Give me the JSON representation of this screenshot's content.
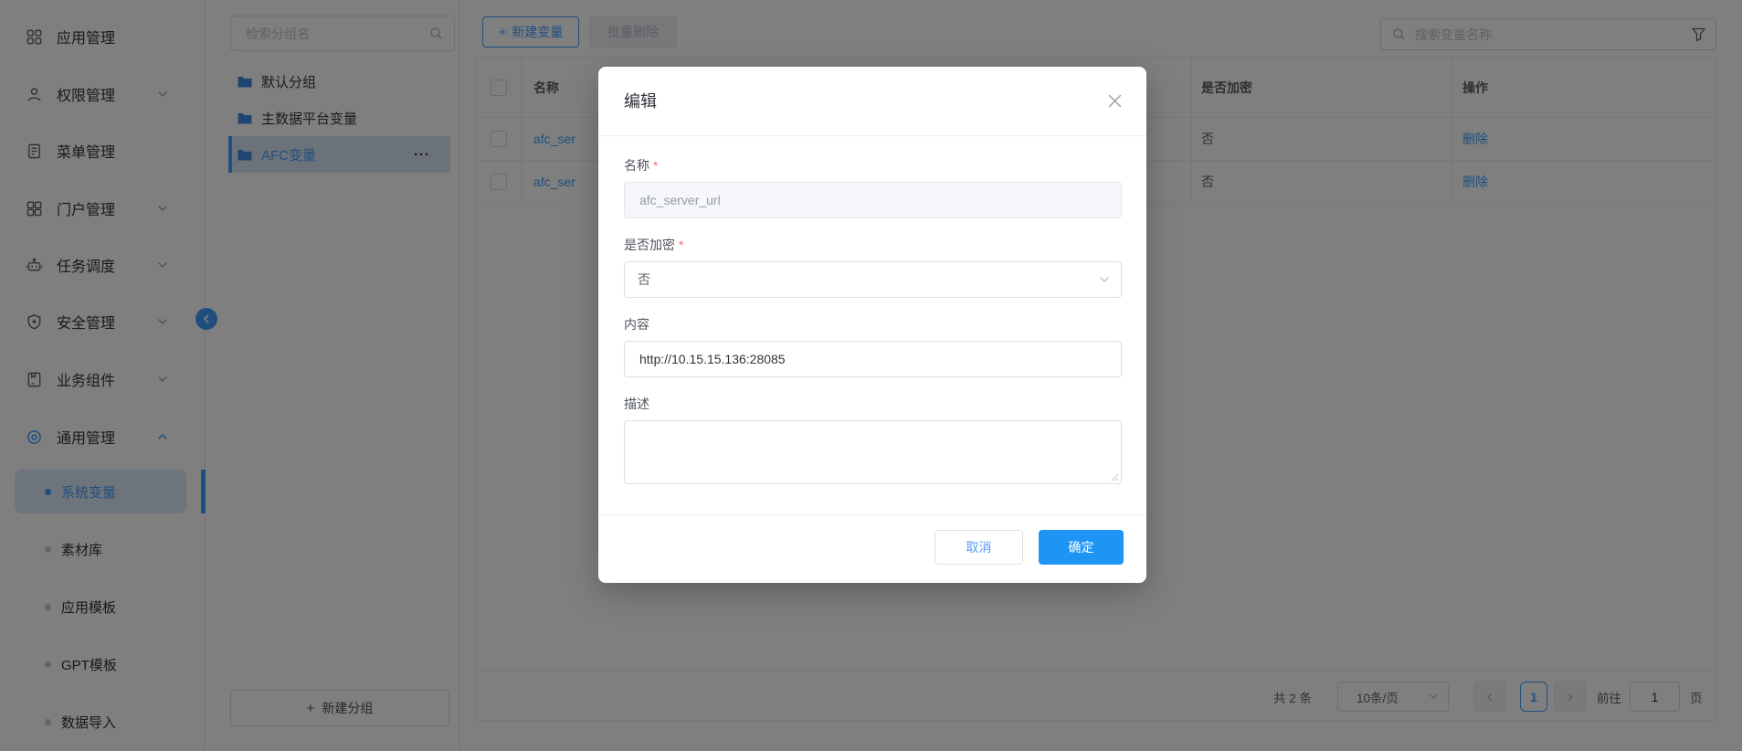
{
  "icons": {
    "plus": "+",
    "more": "···"
  },
  "sidebar": {
    "items": [
      {
        "label": "应用管理"
      },
      {
        "label": "权限管理"
      },
      {
        "label": "菜单管理"
      },
      {
        "label": "门户管理"
      },
      {
        "label": "任务调度"
      },
      {
        "label": "安全管理"
      },
      {
        "label": "业务组件"
      },
      {
        "label": "通用管理"
      }
    ],
    "submenu": [
      {
        "label": "系统变量"
      },
      {
        "label": "素材库"
      },
      {
        "label": "应用模板"
      },
      {
        "label": "GPT模板"
      },
      {
        "label": "数据导入"
      }
    ]
  },
  "groups": {
    "search_placeholder": "检索分组名",
    "items": [
      {
        "label": "默认分组"
      },
      {
        "label": "主数据平台变量"
      },
      {
        "label": "AFC变量"
      }
    ],
    "new_group": "新建分组"
  },
  "toolbar": {
    "new_variable": "新建变量",
    "batch_delete": "批量删除",
    "search_placeholder": "搜索变量名称"
  },
  "table": {
    "headers": {
      "name": "名称",
      "encrypted": "是否加密",
      "actions": "操作"
    },
    "rows": [
      {
        "name": "afc_ser",
        "encrypted": "否",
        "delete": "删除"
      },
      {
        "name": "afc_ser",
        "encrypted": "否",
        "delete": "删除"
      }
    ]
  },
  "pagination": {
    "total": "共 2 条",
    "page_size": "10条/页",
    "page": "1",
    "goto": "前往",
    "goto_value": "1",
    "unit": "页"
  },
  "modal": {
    "title": "编辑",
    "required_mark": "*",
    "name_label": "名称",
    "name_value": "afc_server_url",
    "encrypt_label": "是否加密",
    "encrypt_value": "否",
    "content_label": "内容",
    "content_value": "http://10.15.15.136:28085",
    "desc_label": "描述",
    "desc_value": "",
    "cancel": "取消",
    "confirm": "确定"
  },
  "colors": {
    "primary": "#409eff",
    "confirm_blue": "#1e95f4",
    "required": "#f56c6c"
  }
}
